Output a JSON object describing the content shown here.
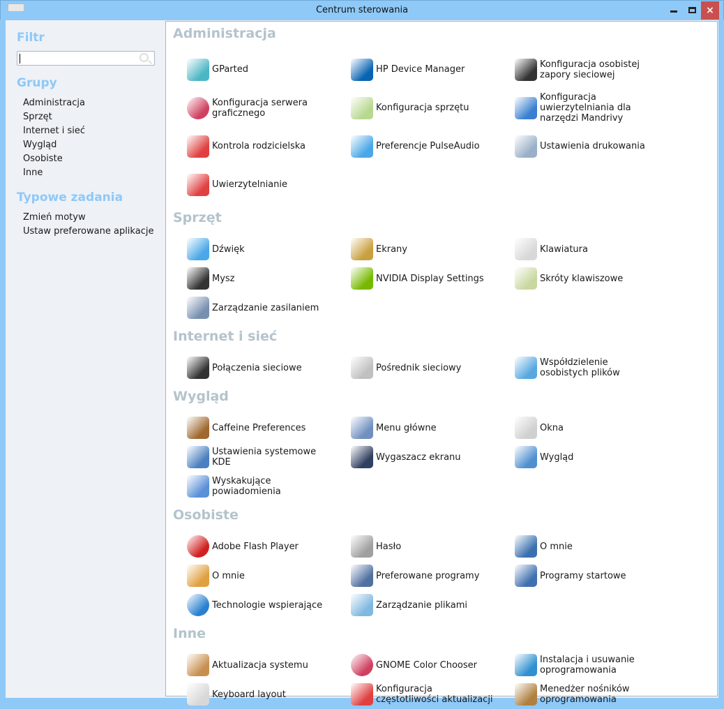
{
  "window": {
    "title": "Centrum sterowania",
    "close": "×"
  },
  "sidebar": {
    "filter_heading": "Filtr",
    "search_value": "",
    "groups_heading": "Grupy",
    "groups": [
      "Administracja",
      "Sprzęt",
      "Internet i sieć",
      "Wygląd",
      "Osobiste",
      "Inne"
    ],
    "tasks_heading": "Typowe zadania",
    "tasks": [
      "Zmień motyw",
      "Ustaw preferowane aplikacje"
    ]
  },
  "sections": [
    {
      "title": "Administracja",
      "items": [
        {
          "label": "GParted",
          "icon": "gparted-icon",
          "color": "#4db6c4"
        },
        {
          "label": "HP Device Manager",
          "icon": "hp-icon",
          "color": "#0a64b4"
        },
        {
          "label": "Konfiguracja osobistej zapory sieciowej",
          "icon": "firewall-icon",
          "color": "#333333"
        },
        {
          "label": "Konfiguracja serwera graficznego",
          "icon": "color-wheel-icon",
          "color": "#d04060"
        },
        {
          "label": "Konfiguracja sprzętu",
          "icon": "hardware-search-icon",
          "color": "#b8d890"
        },
        {
          "label": "Konfiguracja uwierzytelniania dla narzędzi Mandrivy",
          "icon": "monitor-lock-icon",
          "color": "#3a7fd0"
        },
        {
          "label": "Kontrola rodzicielska",
          "icon": "parental-control-icon",
          "color": "#e04040"
        },
        {
          "label": "Preferencje PulseAudio",
          "icon": "speaker-icon",
          "color": "#4aa8e8"
        },
        {
          "label": "Ustawienia drukowania",
          "icon": "printer-icon",
          "color": "#9ab0c8"
        },
        {
          "label": "Uwierzytelnianie",
          "icon": "auth-icon",
          "color": "#e04040"
        }
      ]
    },
    {
      "title": "Sprzęt",
      "items": [
        {
          "label": "Dźwięk",
          "icon": "speaker-icon",
          "color": "#4aa8e8"
        },
        {
          "label": "Ekrany",
          "icon": "display-icon",
          "color": "#c8a040"
        },
        {
          "label": "Klawiatura",
          "icon": "keyboard-icon",
          "color": "#d8d8d8"
        },
        {
          "label": "Mysz",
          "icon": "mouse-icon",
          "color": "#333333"
        },
        {
          "label": "NVIDIA Display Settings",
          "icon": "nvidia-icon",
          "color": "#76b900"
        },
        {
          "label": "Skróty klawiszowe",
          "icon": "shortcuts-icon",
          "color": "#c8d8a0"
        },
        {
          "label": "Zarządzanie zasilaniem",
          "icon": "power-icon",
          "color": "#7890b0"
        }
      ]
    },
    {
      "title": "Internet i sieć",
      "items": [
        {
          "label": "Połączenia sieciowe",
          "icon": "network-icon",
          "color": "#333333"
        },
        {
          "label": "Pośrednik sieciowy",
          "icon": "proxy-icon",
          "color": "#c0c0c0"
        },
        {
          "label": "Współdzielenie osobistych plików",
          "icon": "file-sharing-icon",
          "color": "#58a8e0"
        }
      ]
    },
    {
      "title": "Wygląd",
      "items": [
        {
          "label": "Caffeine Preferences",
          "icon": "coffee-icon",
          "color": "#a06830"
        },
        {
          "label": "Menu główne",
          "icon": "menu-icon",
          "color": "#7090c0"
        },
        {
          "label": "Okna",
          "icon": "windows-icon",
          "color": "#d0d0d0"
        },
        {
          "label": "Ustawienia systemowe KDE",
          "icon": "tools-icon",
          "color": "#4a80c0"
        },
        {
          "label": "Wygaszacz ekranu",
          "icon": "screensaver-icon",
          "color": "#304060"
        },
        {
          "label": "Wygląd",
          "icon": "appearance-icon",
          "color": "#5090d0"
        },
        {
          "label": "Wyskakujące powiadomienia",
          "icon": "notification-icon",
          "color": "#5a90d8"
        }
      ]
    },
    {
      "title": "Osobiste",
      "items": [
        {
          "label": "Adobe Flash Player",
          "icon": "flash-icon",
          "color": "#d02020"
        },
        {
          "label": "Hasło",
          "icon": "password-icon",
          "color": "#a0a0a0"
        },
        {
          "label": "O mnie",
          "icon": "user-photo-icon",
          "color": "#3a70b0"
        },
        {
          "label": "O mnie",
          "icon": "user-info-icon",
          "color": "#e0a040"
        },
        {
          "label": "Preferowane programy",
          "icon": "preferred-apps-icon",
          "color": "#5070a0"
        },
        {
          "label": "Programy startowe",
          "icon": "startup-icon",
          "color": "#4070b0"
        },
        {
          "label": "Technologie wspierające",
          "icon": "accessibility-icon",
          "color": "#2a80d0"
        },
        {
          "label": "Zarządzanie plikami",
          "icon": "file-manager-icon",
          "color": "#80b8e0"
        }
      ]
    },
    {
      "title": "Inne",
      "items": [
        {
          "label": "Aktualizacja systemu",
          "icon": "update-icon",
          "color": "#c89050"
        },
        {
          "label": "GNOME Color Chooser",
          "icon": "color-wheel-icon",
          "color": "#d04060"
        },
        {
          "label": "Instalacja i usuwanie oprogramowania",
          "icon": "software-install-icon",
          "color": "#3090d0"
        },
        {
          "label": "Keyboard layout",
          "icon": "keyboard-icon",
          "color": "#d8d8d8"
        },
        {
          "label": "Konfiguracja częstotliwości aktualizacji",
          "icon": "update-freq-icon",
          "color": "#e04040"
        },
        {
          "label": "Menedżer nośników oprogramowania",
          "icon": "rpm-icon",
          "color": "#b08040"
        }
      ]
    }
  ]
}
